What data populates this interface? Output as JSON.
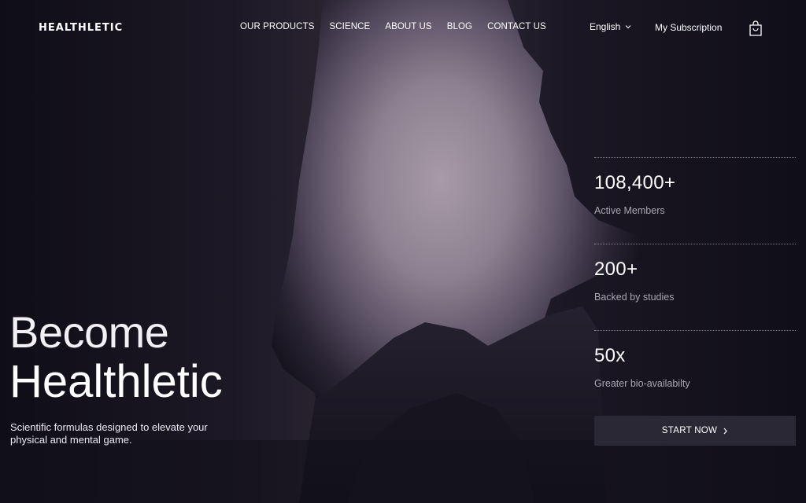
{
  "brand": {
    "logo_text": "HEALTHLETIC"
  },
  "nav": {
    "items": [
      {
        "label": "OUR PRODUCTS"
      },
      {
        "label": "SCIENCE"
      },
      {
        "label": "ABOUT US"
      },
      {
        "label": "BLOG"
      },
      {
        "label": "CONTACT US"
      }
    ],
    "language": "English",
    "subscription": "My Subscription",
    "cart_icon": "shopping-bag-icon"
  },
  "hero": {
    "line1": "Become",
    "line2": "Healthletic",
    "tagline": "Scientific formulas designed to elevate your physical and mental game."
  },
  "stats": [
    {
      "value": "108,400+",
      "label": "Active Members"
    },
    {
      "value": "200+",
      "label": "Backed by studies"
    },
    {
      "value": "50x",
      "label": "Greater bio-availabilty"
    }
  ],
  "cta": {
    "label": "START NOW",
    "icon": "chevron-right-icon"
  },
  "colors": {
    "background": "#14121e",
    "sky": "#a89aa8",
    "cta_bg": "#2a2835",
    "muted_text": "#a9a5b2"
  }
}
